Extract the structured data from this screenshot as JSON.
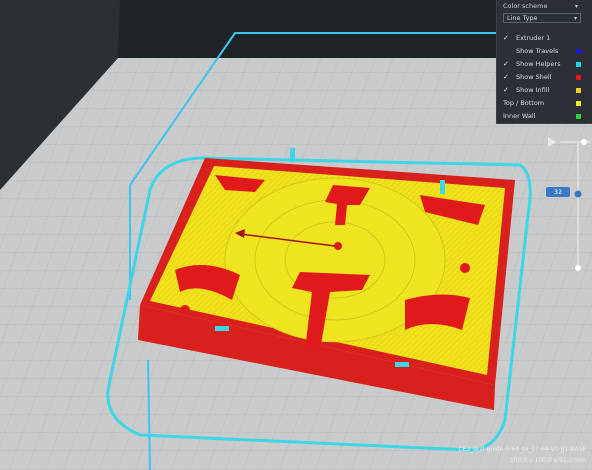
{
  "color_scheme": {
    "title": "Color scheme",
    "mode": "Line Type",
    "items": [
      {
        "label": "Extruder 1",
        "checked": true,
        "swatch": ""
      },
      {
        "label": "Show Travels",
        "checked": false,
        "swatch": "#1a1ad8"
      },
      {
        "label": "Show Helpers",
        "checked": true,
        "swatch": "#1ad8e6"
      },
      {
        "label": "Show Shell",
        "checked": true,
        "swatch": "#e01a1a"
      },
      {
        "label": "Show Infill",
        "checked": true,
        "swatch": "#f0d21a"
      }
    ],
    "legend": [
      {
        "label": "Top / Bottom",
        "swatch": "#f3f01a"
      },
      {
        "label": "Inner Wall",
        "swatch": "#2ed13a"
      }
    ]
  },
  "layer_view": {
    "current_layer": "32"
  },
  "colors": {
    "background": "#1f2427",
    "build_plate": "#c9cbcc",
    "volume_outline": "#3ec4ef",
    "shell": "#e01a1a",
    "infill": "#f0d21a",
    "helper": "#3ed6e6",
    "accent": "#3b79c2"
  },
  "footer": {
    "file_name": "CE3_drill-guide-5-64_to_17-64-V3-JJ1-BASE",
    "dimensions": "100.0 x 100.0 x 91.2 mm"
  }
}
